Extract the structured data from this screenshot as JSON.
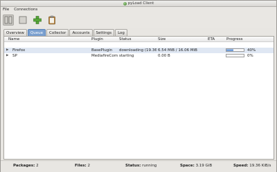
{
  "window": {
    "title": "pyLoad Client"
  },
  "menubar": {
    "items": [
      "File",
      "Connections"
    ]
  },
  "toolbar": {
    "buttons": [
      {
        "icon": "pause-icon"
      },
      {
        "icon": "stop-icon"
      },
      {
        "icon": "add-icon"
      },
      {
        "icon": "clipboard-icon"
      }
    ]
  },
  "tabs": [
    "Overview",
    "Queue",
    "Collector",
    "Accounts",
    "Settings",
    "Log"
  ],
  "active_tab": "Queue",
  "queue": {
    "columns": [
      "Name",
      "Plugin",
      "Status",
      "Size",
      "ETA",
      "Progress"
    ],
    "rows": [
      {
        "name": "Firefox",
        "plugin": "BasePlugin",
        "status": "downloading (19.36…",
        "size": "6.54 MiB / 16.06 MiB",
        "eta": "",
        "progress_text": "40%",
        "progress": 40
      },
      {
        "name": "SP",
        "plugin": "MediafireCom",
        "status": "starting",
        "size": "0.00 B",
        "eta": "",
        "progress_text": "0%",
        "progress": 0
      }
    ]
  },
  "status": {
    "packages_label": "Packages:",
    "packages": "2",
    "files_label": "Files:",
    "files": "2",
    "status_label": "Status:",
    "status": "running",
    "space_label": "Space:",
    "space": "3.19 GiB",
    "speed_label": "Speed:",
    "speed": "19.36 KiB/s"
  },
  "colors": {
    "accent": "#7aa0d0",
    "progress": "#5d8fd3",
    "selected_row": "#dfe7f3"
  }
}
